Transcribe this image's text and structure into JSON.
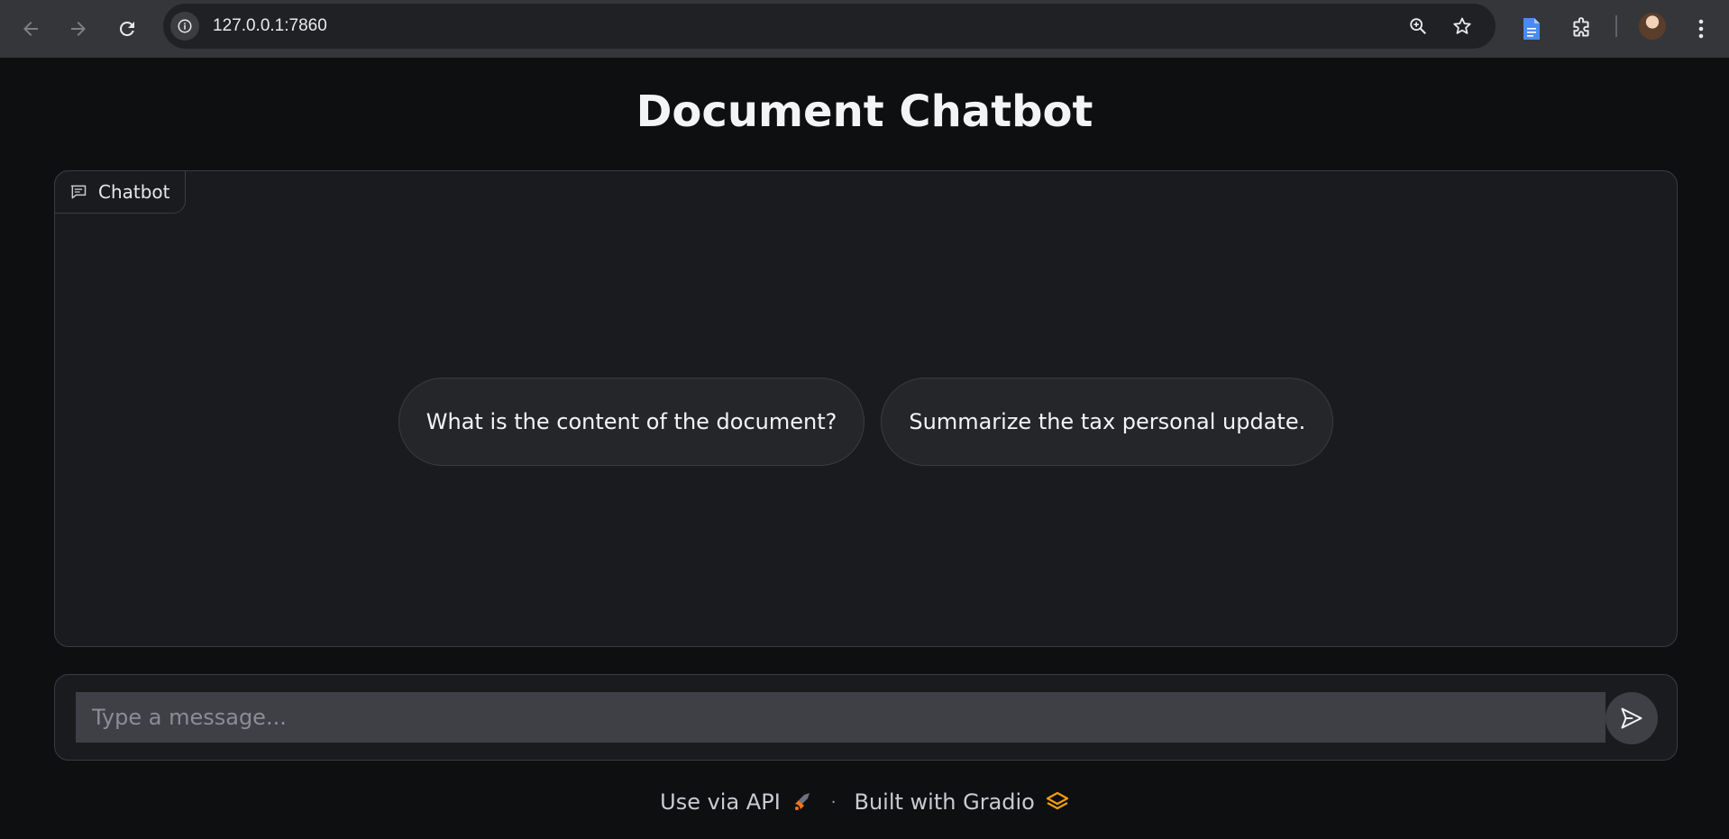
{
  "browser": {
    "url": "127.0.0.1:7860"
  },
  "page": {
    "title": "Document Chatbot"
  },
  "chatbot": {
    "label": "Chatbot",
    "examples": [
      "What is the content of the document?",
      "Summarize the tax personal update."
    ]
  },
  "input": {
    "placeholder": "Type a message...",
    "value": ""
  },
  "footer": {
    "api_label": "Use via API",
    "separator": "·",
    "built_label": "Built with Gradio"
  },
  "colors": {
    "background": "#0e0f11",
    "panel": "#1a1b1e",
    "input": "#3f4046",
    "accent_api": "#f97316",
    "accent_gradio": "#f59e0b"
  }
}
